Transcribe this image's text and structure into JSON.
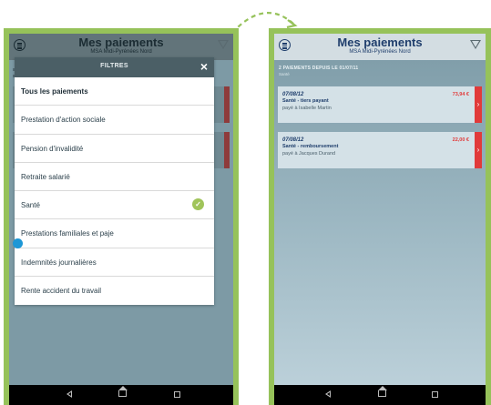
{
  "app": {
    "title": "Mes paiements",
    "subtitle": "MSA Midi-Pyrénées Nord"
  },
  "icons": {
    "menu": "menu-circle-icon",
    "filter": "funnel-icon",
    "close": "close-icon",
    "check": "checkmark-icon",
    "card_arrow": "chevron-right-icon",
    "nav_back": "back-triangle-icon",
    "nav_home": "home-icon",
    "nav_recent": "recent-apps-icon"
  },
  "colors": {
    "phone_frame": "#96c25a",
    "accent_red": "#e13a3a",
    "title_blue": "#1f3e6c",
    "check_green": "#a0c45a",
    "dot_blue": "#1d97d6"
  },
  "filter_dialog": {
    "title": "FILTRES",
    "close_label": "×",
    "items": [
      {
        "label": "Tous les paiements",
        "selected": false,
        "bold": true
      },
      {
        "label": "Prestation d'action sociale",
        "selected": false,
        "bold": false
      },
      {
        "label": "Pension d'invalidité",
        "selected": false,
        "bold": false
      },
      {
        "label": "Retraite salarié",
        "selected": false,
        "bold": false
      },
      {
        "label": "Santé",
        "selected": true,
        "bold": false
      },
      {
        "label": "Prestations familiales et paje",
        "selected": false,
        "bold": false
      },
      {
        "label": "Indemnités journalières",
        "selected": false,
        "bold": false
      },
      {
        "label": "Rente accident du travail",
        "selected": false,
        "bold": false
      }
    ]
  },
  "payments": {
    "section_label": "2 PAIEMENTS DEPUIS LE 01/07/11",
    "section_sub": "Santé",
    "items": [
      {
        "date": "07/08/12",
        "description": "Santé - tiers payant",
        "payee": "payé à Isabelle Martin",
        "amount": "73,94 €"
      },
      {
        "date": "07/08/12",
        "description": "Santé - remboursement",
        "payee": "payé à Jacques Durand",
        "amount": "22,00 €"
      }
    ]
  }
}
